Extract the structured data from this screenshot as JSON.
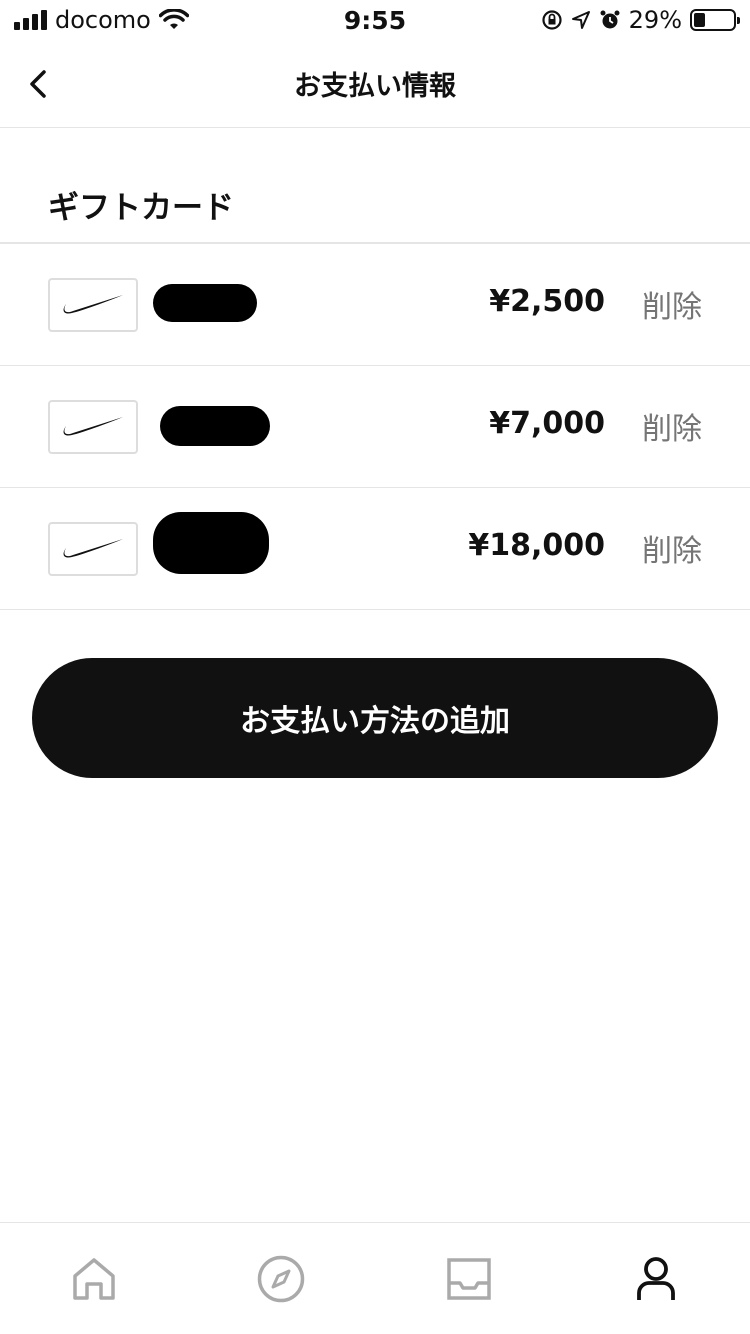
{
  "status_bar": {
    "carrier": "docomo",
    "time": "9:55",
    "battery": "29%",
    "battery_level": 0.29
  },
  "header": {
    "title": "お支払い情報"
  },
  "section": {
    "title": "ギフトカード"
  },
  "gift_cards": [
    {
      "amount": "¥2,500",
      "delete_label": "削除",
      "logo": "nike-swoosh-icon"
    },
    {
      "amount": "¥7,000",
      "delete_label": "削除",
      "logo": "nike-swoosh-icon"
    },
    {
      "amount": "¥18,000",
      "delete_label": "削除",
      "logo": "nike-swoosh-icon"
    }
  ],
  "add_button": {
    "label": "お支払い方法の追加"
  },
  "tabs": [
    {
      "icon": "home-icon",
      "active": false
    },
    {
      "icon": "compass-icon",
      "active": false
    },
    {
      "icon": "inbox-icon",
      "active": false
    },
    {
      "icon": "profile-icon",
      "active": true
    }
  ],
  "colors": {
    "primary": "#111111",
    "muted": "#757575",
    "inactive_icon": "#aaaaaa",
    "divider": "#e5e5e5"
  }
}
